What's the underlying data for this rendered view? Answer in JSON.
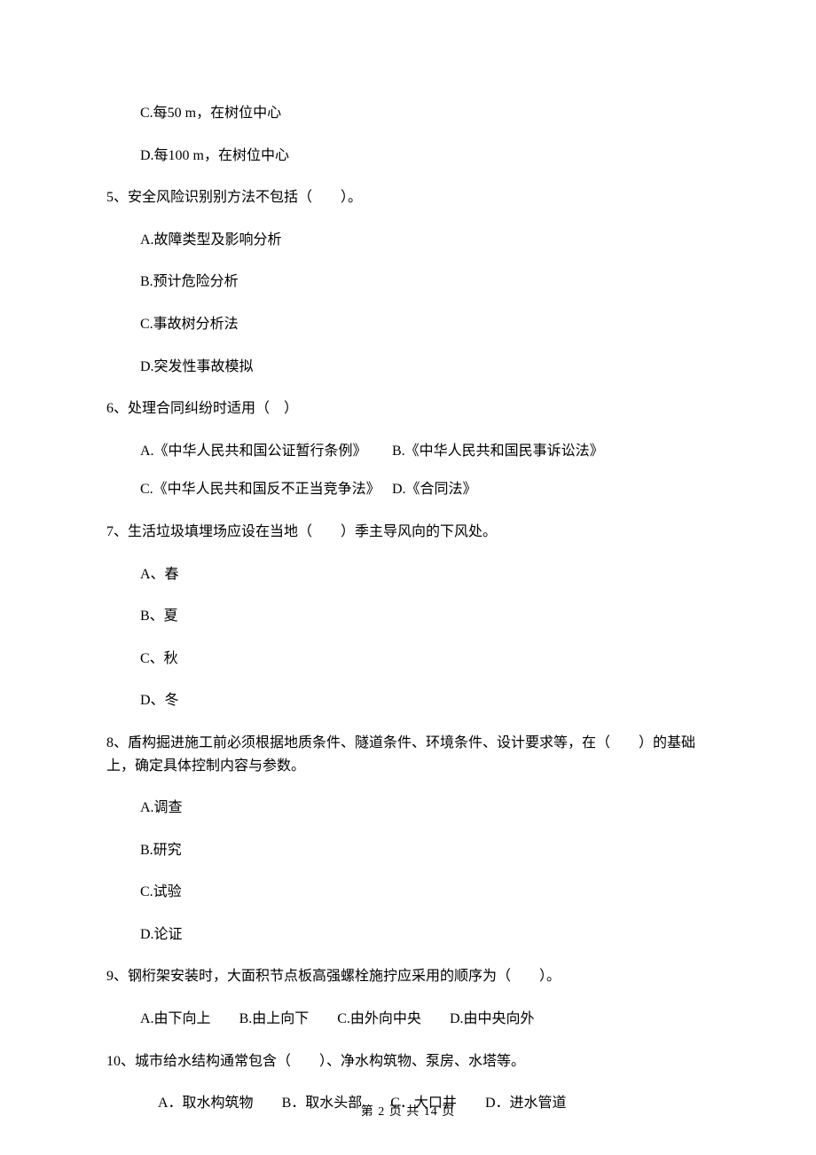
{
  "opt_c_prev": "C.每50 m，在树位中心",
  "opt_d_prev": "D.每100 m，在树位中心",
  "q5": {
    "text": "5、安全风险识别别方法不包括（　　）。",
    "a": "A.故障类型及影响分析",
    "b": "B.预计危险分析",
    "c": "C.事故树分析法",
    "d": "D.突发性事故模拟"
  },
  "q6": {
    "text": "6、处理合同纠纷时适用（　）",
    "a": "A.《中华人民共和国公证暂行条例》",
    "b": "B.《中华人民共和国民事诉讼法》",
    "c": "C.《中华人民共和国反不正当竞争法》",
    "d": "D.《合同法》"
  },
  "q7": {
    "text": "7、生活垃圾填埋场应设在当地（　　）季主导风向的下风处。",
    "a": "A、春",
    "b": "B、夏",
    "c": "C、秋",
    "d": "D、冬"
  },
  "q8": {
    "text": "8、盾构掘进施工前必须根据地质条件、隧道条件、环境条件、设计要求等，在（　　）的基础上，确定具体控制内容与参数。",
    "a": "A.调查",
    "b": "B.研究",
    "c": "C.试验",
    "d": "D.论证"
  },
  "q9": {
    "text": "9、钢桁架安装时，大面积节点板高强螺栓施拧应采用的顺序为（　　）。",
    "a": "A.由下向上",
    "b": "B.由上向下",
    "c": "C.由外向中央",
    "d": "D.由中央向外"
  },
  "q10": {
    "text": "10、城市给水结构通常包含（　　）、净水构筑物、泵房、水塔等。",
    "a": "A．取水构筑物",
    "b": "B．取水头部",
    "c": "C．大口井",
    "d": "D．进水管道"
  },
  "footer": "第 2 页 共 14 页"
}
